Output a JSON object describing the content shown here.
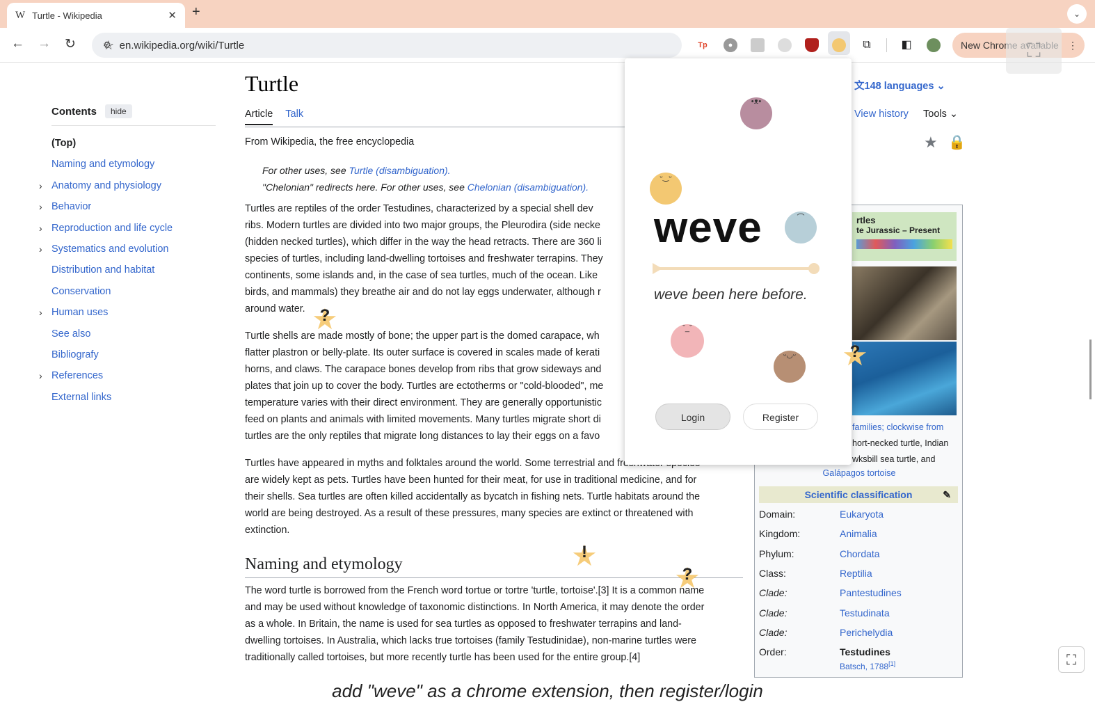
{
  "browser": {
    "tab_title": "Turtle - Wikipedia",
    "tab_favicon": "W",
    "url": "en.wikipedia.org/wiki/Turtle",
    "new_chrome_label": "New Chrome available"
  },
  "toc": {
    "title": "Contents",
    "hide": "hide",
    "items": [
      {
        "label": "(Top)"
      },
      {
        "label": "Naming and etymology"
      },
      {
        "label": "Anatomy and physiology",
        "expandable": true
      },
      {
        "label": "Behavior",
        "expandable": true
      },
      {
        "label": "Reproduction and life cycle",
        "expandable": true
      },
      {
        "label": "Systematics and evolution",
        "expandable": true
      },
      {
        "label": "Distribution and habitat"
      },
      {
        "label": "Conservation"
      },
      {
        "label": "Human uses",
        "expandable": true
      },
      {
        "label": "See also"
      },
      {
        "label": "Bibliografy"
      },
      {
        "label": "References",
        "expandable": true
      },
      {
        "label": "External links"
      }
    ]
  },
  "article": {
    "title": "Turtle",
    "tab_article": "Article",
    "tab_talk": "Talk",
    "languages": "148 languages",
    "view_history": "View history",
    "tools": "Tools",
    "from": "From Wikipedia, the free encyclopedia",
    "hat1": "For other uses, see",
    "hat1_link": "Turtle (disambiguation).",
    "hat2": "\"Chelonian\" redirects here. For other uses, see",
    "hat2_link": "Chelonian (disambiguation).",
    "section2": "Naming and etymology",
    "p1_lines": [
      "Turtles are reptiles of the order Testudines, characterized by a special shell dev",
      "ribs. Modern turtles are divided into two major groups, the Pleurodira (side necke",
      "(hidden necked turtles), which differ in the way the head retracts. There are 360 li",
      "species of turtles, including land-dwelling tortoises and freshwater terrapins. They",
      "continents, some islands and, in the case of sea turtles, much of the ocean. Like",
      "birds, and mammals) they breathe air and do not lay eggs underwater, although r",
      "around water."
    ],
    "p2_lines": [
      "Turtle shells are made mostly of bone; the upper part is the domed carapace, wh",
      "flatter plastron or belly-plate. Its outer surface is covered in scales made of kerati",
      "horns, and claws. The carapace bones develop from ribs that grow sideways and",
      "plates that join up to cover the body. Turtles are ectotherms or \"cold-blooded\", me",
      "temperature varies with their direct environment. They are generally opportunistic",
      "feed on plants and animals with limited movements. Many turtles migrate short di",
      "turtles are the only reptiles that migrate long distances to lay their eggs on a favo"
    ],
    "p3_lines": [
      "Turtles have appeared in myths and folktales around the world. Some terrestrial and freshwater species",
      "are widely kept as pets. Turtles have been hunted for their meat, for use in traditional medicine, and for",
      "their shells. Sea turtles are often killed accidentally as bycatch in fishing nets. Turtle habitats around the",
      "world are being destroyed. As a result of these pressures, many species are extinct or threatened with",
      "extinction."
    ],
    "p4_lines": [
      "The word turtle is borrowed from the French word tortue or tortre 'turtle, tortoise'.[3] It is a common name",
      "and may be used without knowledge of taxonomic distinctions. In North America, it may denote the order",
      "as a whole. In Britain, the name is used for sea turtles as opposed to freshwater terrapins and land-",
      "dwelling tortoises. In Australia, which lacks true tortoises (family Testudinidae), non-marine turtles were",
      "traditionally called tortoises, but more recently turtle has been used for the entire group.[4]"
    ]
  },
  "infobox": {
    "title_line1": "rtles",
    "title_line2": "te Jurassic – Present",
    "caption_lines": [
      "families; clockwise from",
      "hort-necked turtle, Indian",
      "wksbill sea turtle, and"
    ],
    "caption_last": "Galápagos tortoise",
    "sci_head": "Scientific classification",
    "rows": [
      {
        "k": "Domain:",
        "v": "Eukaryota"
      },
      {
        "k": "Kingdom:",
        "v": "Animalia"
      },
      {
        "k": "Phylum:",
        "v": "Chordata"
      },
      {
        "k": "Class:",
        "v": "Reptilia"
      },
      {
        "k": "Clade:",
        "v": "Pantestudines"
      },
      {
        "k": "Clade:",
        "v": "Testudinata"
      },
      {
        "k": "Clade:",
        "v": "Perichelydia"
      },
      {
        "k": "Order:",
        "v": "Testudines"
      }
    ],
    "authority": "Batsch, 1788"
  },
  "popup": {
    "logo": "weve",
    "tagline": "weve been here before.",
    "login": "Login",
    "register": "Register"
  },
  "overlay_caption": "add \"weve\" as a chrome extension, then register/login",
  "marks": {
    "q": "?",
    "ex": "!"
  }
}
